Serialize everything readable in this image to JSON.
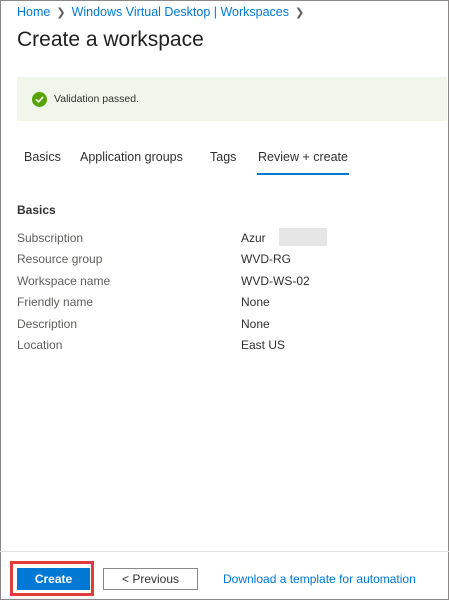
{
  "breadcrumb": {
    "items": [
      "Home",
      "Windows Virtual Desktop | Workspaces"
    ],
    "separator_icon": "chevron-right-icon"
  },
  "page_title": "Create a workspace",
  "banner": {
    "icon": "checkmark-circle-icon",
    "text": "Validation passed.",
    "background": "#f0f6e9",
    "icon_color": "#57a300"
  },
  "tabs": [
    {
      "label": "Basics",
      "active": false
    },
    {
      "label": "Application groups",
      "active": false
    },
    {
      "label": "Tags",
      "active": false
    },
    {
      "label": "Review + create",
      "active": true
    }
  ],
  "summary": {
    "heading": "Basics",
    "rows": [
      {
        "label": "Subscription",
        "value": "Azur"
      },
      {
        "label": "Resource group",
        "value": "WVD-RG"
      },
      {
        "label": "Workspace name",
        "value": "WVD-WS-02"
      },
      {
        "label": "Friendly name",
        "value": "None"
      },
      {
        "label": "Description",
        "value": "None"
      },
      {
        "label": "Location",
        "value": "East US"
      }
    ]
  },
  "footer": {
    "create_label": "Create",
    "previous_label": "< Previous",
    "download_label": "Download a template for automation"
  },
  "colors": {
    "accent": "#0078d4",
    "highlight": "#e23b3b"
  }
}
